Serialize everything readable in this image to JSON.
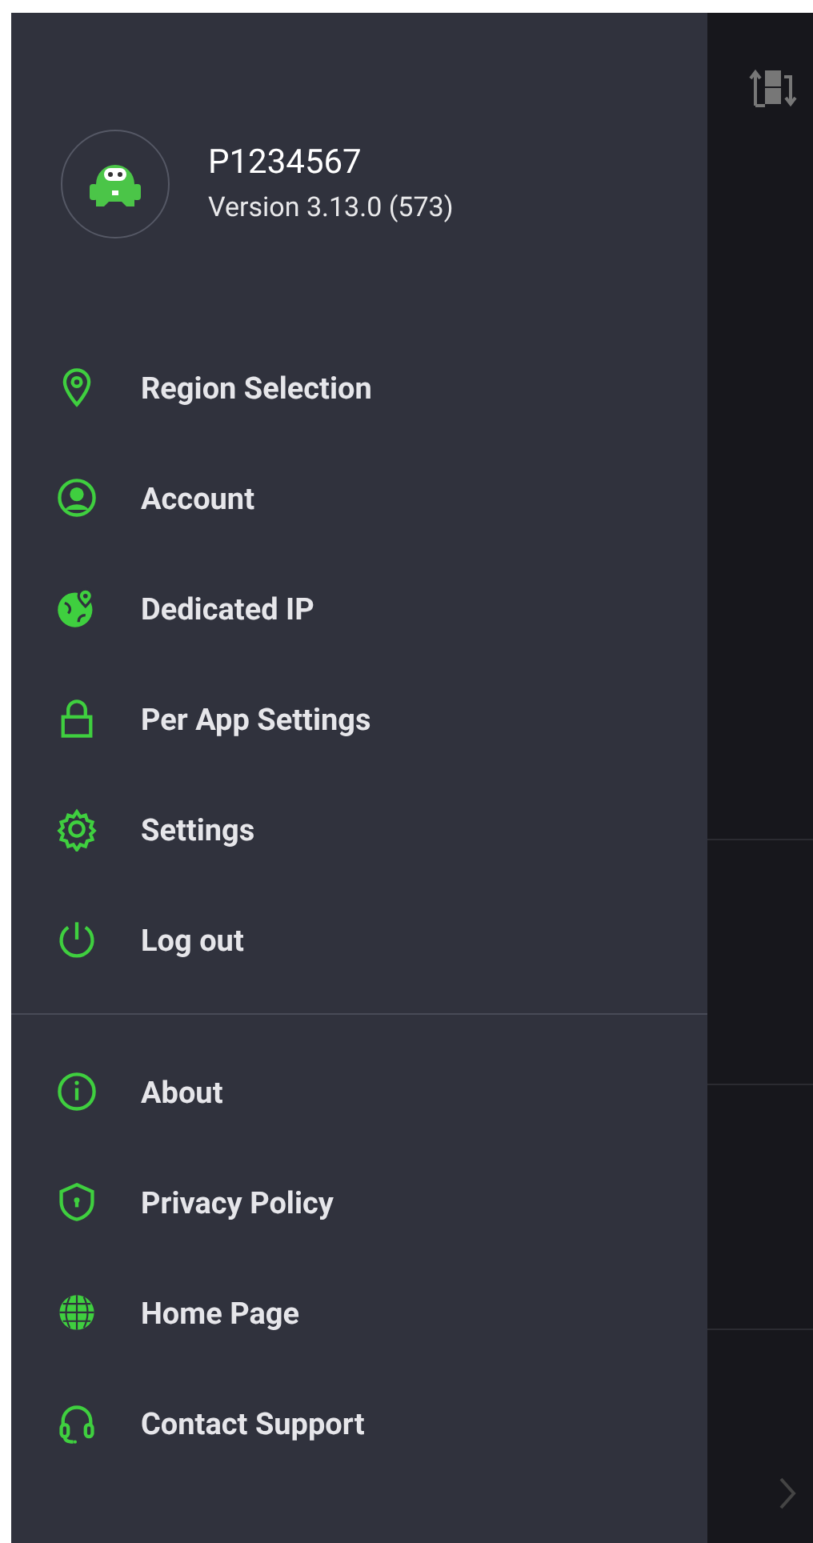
{
  "header": {
    "username": "P1234567",
    "version": "Version 3.13.0 (573)"
  },
  "menu_groups": [
    {
      "items": [
        {
          "label": "Region Selection"
        },
        {
          "label": "Account"
        },
        {
          "label": "Dedicated IP"
        },
        {
          "label": "Per App Settings"
        },
        {
          "label": "Settings"
        },
        {
          "label": "Log out"
        }
      ]
    },
    {
      "items": [
        {
          "label": "About"
        },
        {
          "label": "Privacy Policy"
        },
        {
          "label": "Home Page"
        },
        {
          "label": "Contact Support"
        }
      ]
    }
  ]
}
